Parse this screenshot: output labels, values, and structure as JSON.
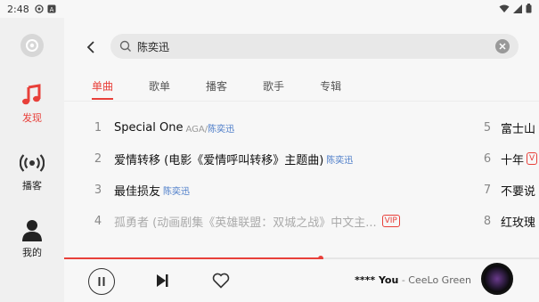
{
  "status_bar": {
    "time": "2:48"
  },
  "nav": {
    "items": [
      {
        "label": "发现",
        "icon": "music-note-icon",
        "active": true
      },
      {
        "label": "播客",
        "icon": "broadcast-icon",
        "active": false
      },
      {
        "label": "我的",
        "icon": "person-icon",
        "active": false
      }
    ]
  },
  "search": {
    "query": "陈奕迅"
  },
  "tabs": [
    "单曲",
    "歌单",
    "播客",
    "歌手",
    "专辑"
  ],
  "songs": [
    {
      "num": "1",
      "title": "Special One",
      "artist_prefix": "AGA/",
      "artist_hl": "陈奕迅",
      "vip": false
    },
    {
      "num": "2",
      "title": "爱情转移 (电影《爱情呼叫转移》主题曲)",
      "artist_prefix": "",
      "artist_hl": "陈奕迅",
      "vip": false
    },
    {
      "num": "3",
      "title": "最佳损友",
      "artist_prefix": "",
      "artist_hl": "陈奕迅",
      "vip": false
    },
    {
      "num": "4",
      "title": "孤勇者 (动画剧集《英雄联盟：双城之战》中文主...",
      "artist_prefix": "",
      "artist_hl": "",
      "vip": true,
      "vip_label": "VIP"
    }
  ],
  "songs_right": [
    {
      "num": "5",
      "title": "富士山"
    },
    {
      "num": "6",
      "title": "十年",
      "vip": true,
      "vip_label": "V"
    },
    {
      "num": "7",
      "title": "不要说"
    },
    {
      "num": "8",
      "title": "红玫瑰"
    }
  ],
  "player": {
    "progress": 0.54,
    "title": "**** You",
    "separator": " - ",
    "artist": "CeeLo Green"
  },
  "colors": {
    "accent": "#e8403a",
    "artist_link": "#4a7bc8"
  }
}
